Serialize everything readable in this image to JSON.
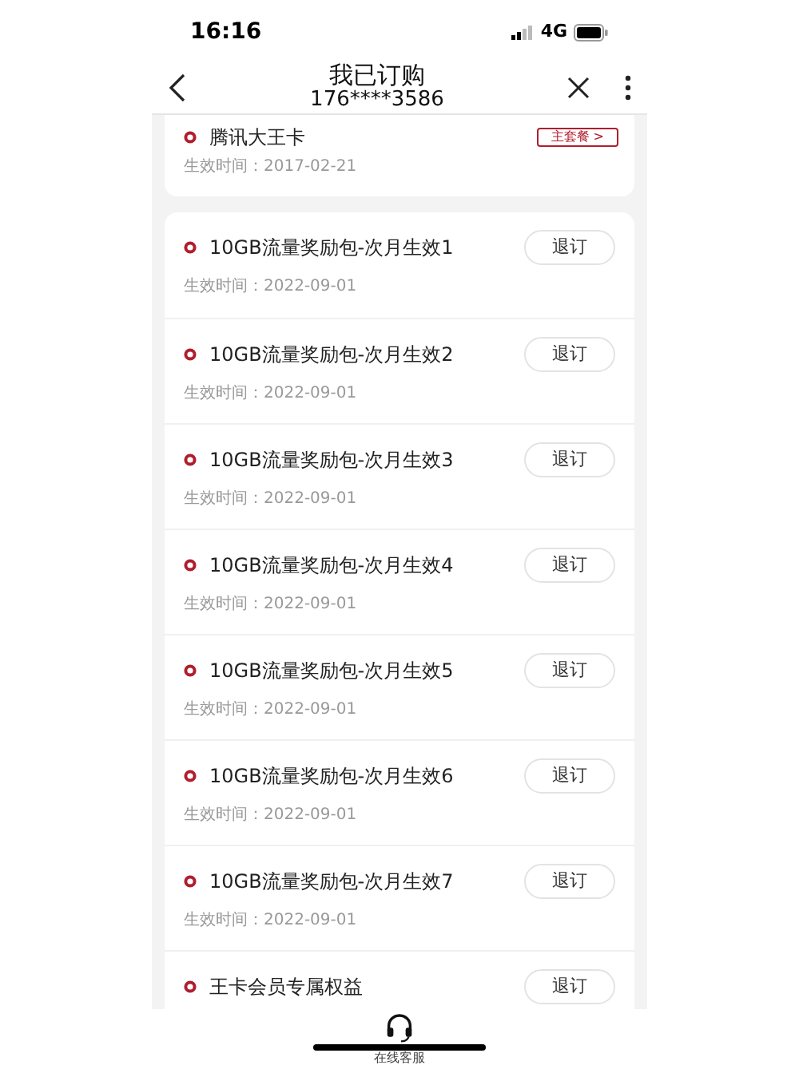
{
  "status_bar": {
    "time": "16:16",
    "network": "4G"
  },
  "nav": {
    "title": "我已订购",
    "subtitle": "176****3586"
  },
  "main_plan": {
    "name": "腾讯大王卡",
    "badge": "主套餐 >",
    "date": "生效时间：2017-02-21"
  },
  "subscriptions": [
    {
      "name": "10GB流量奖励包-次月生效1",
      "date": "生效时间：2022-09-01",
      "button": "退订"
    },
    {
      "name": "10GB流量奖励包-次月生效2",
      "date": "生效时间：2022-09-01",
      "button": "退订"
    },
    {
      "name": "10GB流量奖励包-次月生效3",
      "date": "生效时间：2022-09-01",
      "button": "退订"
    },
    {
      "name": "10GB流量奖励包-次月生效4",
      "date": "生效时间：2022-09-01",
      "button": "退订"
    },
    {
      "name": "10GB流量奖励包-次月生效5",
      "date": "生效时间：2022-09-01",
      "button": "退订"
    },
    {
      "name": "10GB流量奖励包-次月生效6",
      "date": "生效时间：2022-09-01",
      "button": "退订"
    },
    {
      "name": "10GB流量奖励包-次月生效7",
      "date": "生效时间：2022-09-01",
      "button": "退订"
    },
    {
      "name": "王卡会员专属权益",
      "button": "退订"
    }
  ],
  "bottom_bar": {
    "label": "在线客服"
  }
}
